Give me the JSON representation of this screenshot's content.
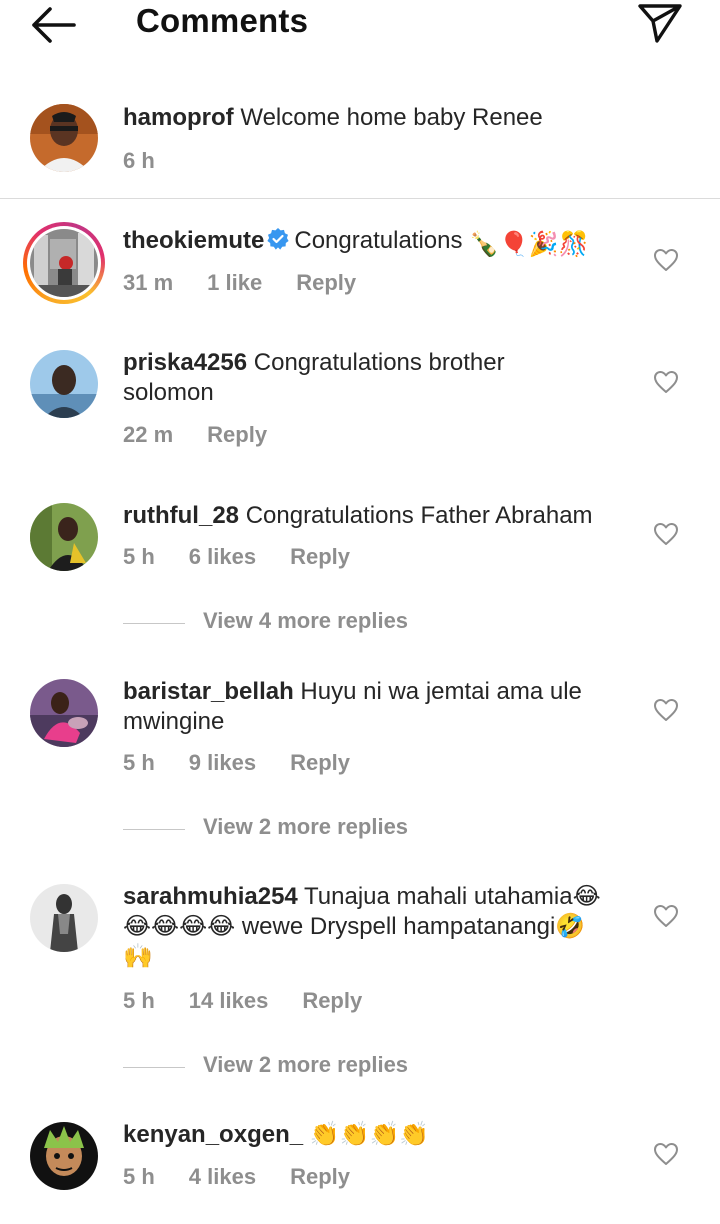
{
  "header": {
    "title": "Comments"
  },
  "caption": {
    "username": "hamoprof",
    "text": "Welcome home baby Renee",
    "time": "6 h"
  },
  "comments": [
    {
      "username": "theokiemute",
      "verified": true,
      "text": "Congratulations",
      "emojis": "🍾🎈🎉🎊",
      "time": "31 m",
      "likes": "1 like",
      "reply": "Reply"
    },
    {
      "username": "priska4256",
      "text_line1": "Congratulations brother",
      "text_line2": "solomon",
      "time": "22 m",
      "reply": "Reply"
    },
    {
      "username": "ruthful_28",
      "text": "Congratulations Father Abraham",
      "time": "5 h",
      "likes": "6 likes",
      "reply": "Reply",
      "view_replies": "View 4 more replies"
    },
    {
      "username": "baristar_bellah",
      "text_line1": "Huyu  ni wa jemtai  ama ule",
      "text_line2": "mwingine",
      "time": "5 h",
      "likes": "9 likes",
      "reply": "Reply",
      "view_replies": "View 2 more replies"
    },
    {
      "username": "sarahmuhia254",
      "text_line1": "Tunajua mahali utahamia😂",
      "text_line2": "😂😂😂😂 wewe Dryspell hampatanangi🤣",
      "text_line3": "🙌",
      "time": "5 h",
      "likes": "14 likes",
      "reply": "Reply",
      "view_replies": "View 2 more replies"
    },
    {
      "username": "kenyan_oxgen_",
      "text": "👏👏👏👏",
      "time": "5 h",
      "likes": "4 likes",
      "reply": "Reply"
    }
  ],
  "icons": {
    "back": "arrow-left-icon",
    "send": "paper-plane-icon",
    "like": "heart-outline-icon",
    "verified": "verified-badge-icon"
  },
  "colors": {
    "text": "#262626",
    "meta": "#8e8e8e",
    "verified": "#3897f0",
    "divider": "#dbdbdb"
  }
}
